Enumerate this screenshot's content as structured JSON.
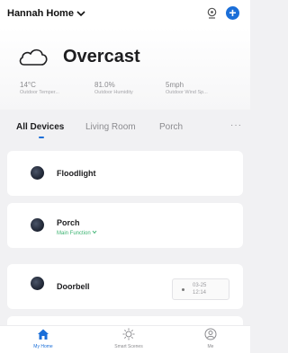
{
  "header": {
    "home_name": "Hannah Home"
  },
  "weather": {
    "condition": "Overcast",
    "stats": [
      {
        "value": "14°C",
        "label": "Outdoor Temper..."
      },
      {
        "value": "81.0%",
        "label": "Outdoor Humidity"
      },
      {
        "value": "5mph",
        "label": "Outdoor Wind Sp..."
      }
    ]
  },
  "tabs": {
    "items": [
      {
        "label": "All Devices"
      },
      {
        "label": "Living Room"
      },
      {
        "label": "Porch"
      }
    ],
    "more": "···"
  },
  "devices": [
    {
      "name": "Floodlight"
    },
    {
      "name": "Porch",
      "function_label": "Main Function"
    },
    {
      "name": "Doorbell",
      "snapshot_time_date": "03-25",
      "snapshot_time_clock": "12:14"
    }
  ],
  "tabbar": {
    "items": [
      {
        "label": "My Home"
      },
      {
        "label": "Smart Scenes"
      },
      {
        "label": "Me"
      }
    ]
  },
  "colors": {
    "accent": "#1a6ed8",
    "function_green": "#3cb371"
  }
}
